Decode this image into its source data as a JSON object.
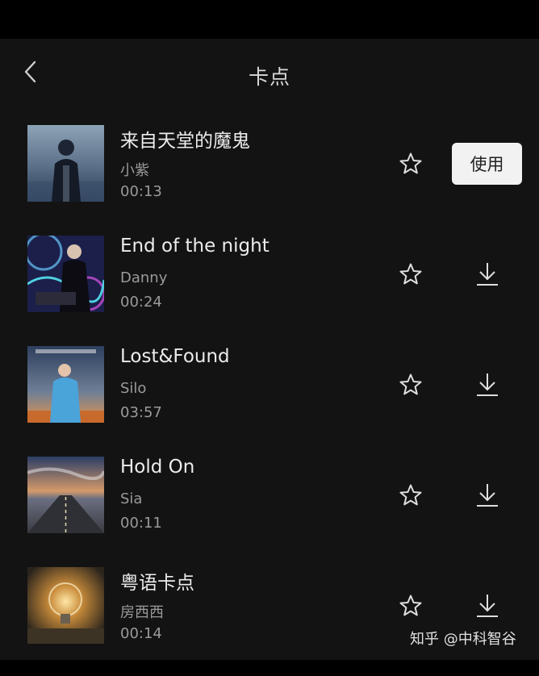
{
  "header": {
    "title": "卡点",
    "back_icon": "chevron-left-icon"
  },
  "songs": [
    {
      "title": "来自天堂的魔鬼",
      "artist": "小紫",
      "duration": "00:13",
      "action": "使用"
    },
    {
      "title": "End of the night",
      "artist": "Danny",
      "duration": "00:24",
      "action": "download"
    },
    {
      "title": "Lost&Found",
      "artist": "Silo",
      "duration": "03:57",
      "action": "download"
    },
    {
      "title": "Hold On",
      "artist": "Sia",
      "duration": "00:11",
      "action": "download"
    },
    {
      "title": "粤语卡点",
      "artist": "房西西",
      "duration": "00:14",
      "action": "download"
    }
  ],
  "watermark": "知乎 @中科智谷",
  "colors": {
    "background": "#131313",
    "status_bar": "#000000",
    "text_primary": "#ececec",
    "text_secondary": "#9a9a9a",
    "use_button_bg": "#f2f2f2"
  }
}
